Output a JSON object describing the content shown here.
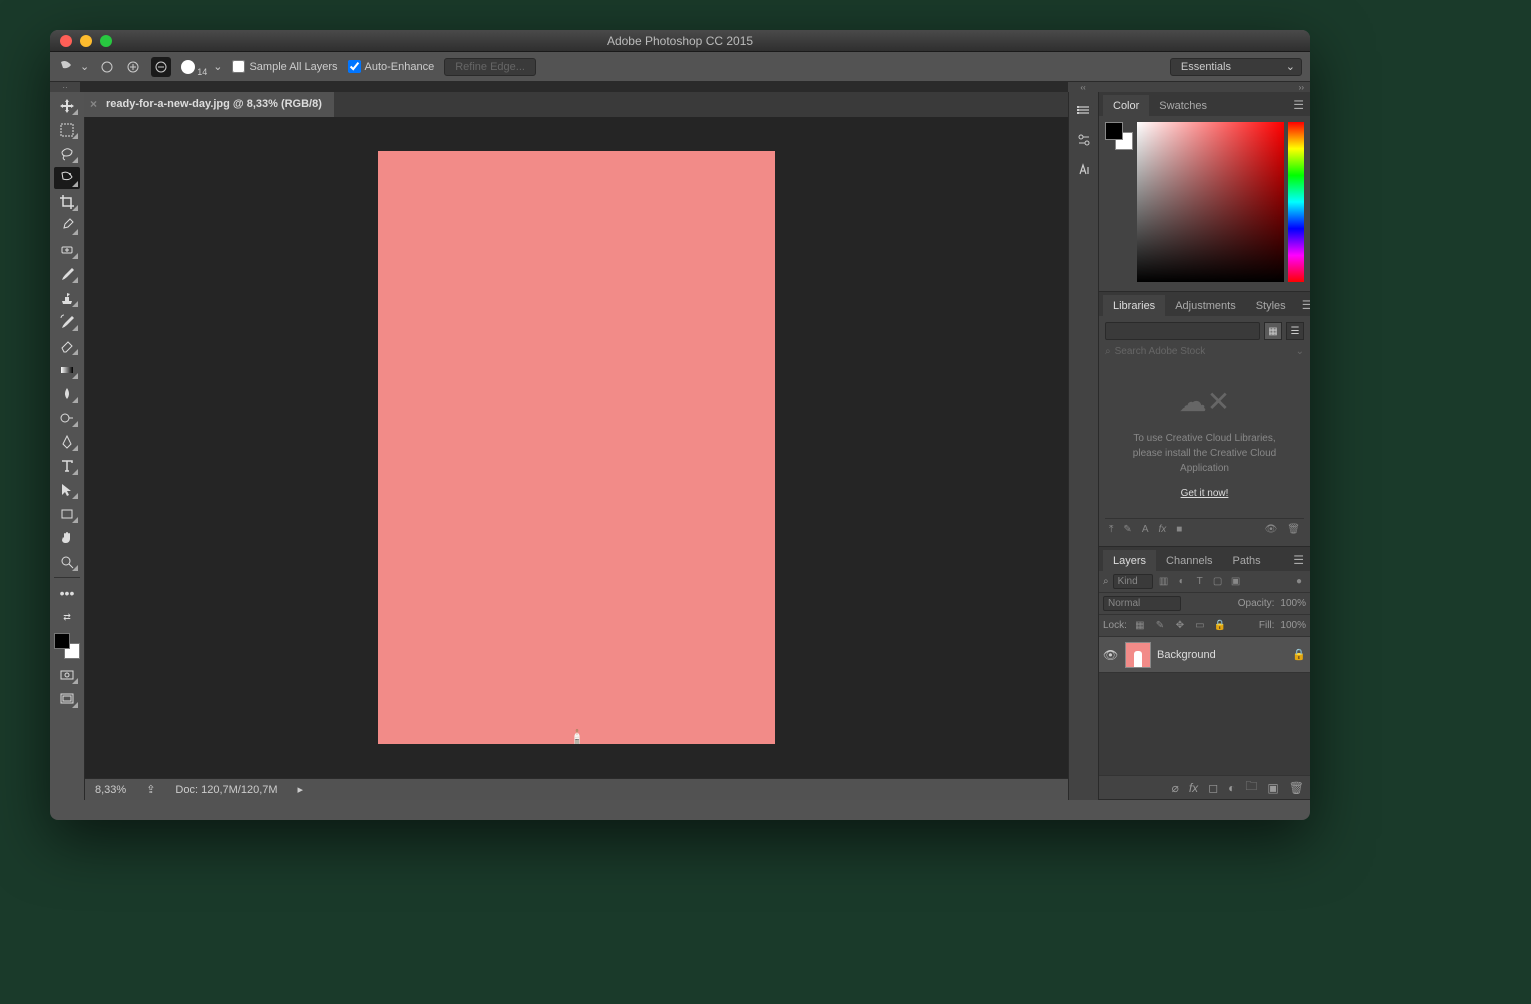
{
  "window": {
    "title": "Adobe Photoshop CC 2015"
  },
  "options": {
    "brush_size": "14",
    "sample_all_layers": {
      "label": "Sample All Layers",
      "checked": false
    },
    "auto_enhance": {
      "label": "Auto-Enhance",
      "checked": true
    },
    "refine_edge": "Refine Edge...",
    "workspace": "Essentials"
  },
  "document": {
    "tab_label": "ready-for-a-new-day.jpg @ 8,33% (RGB/8)"
  },
  "status": {
    "zoom": "8,33%",
    "doc_info": "Doc: 120,7M/120,7M"
  },
  "color_panel": {
    "tabs": [
      "Color",
      "Swatches"
    ]
  },
  "libraries_panel": {
    "tabs": [
      "Libraries",
      "Adjustments",
      "Styles"
    ],
    "search_placeholder": "Search Adobe Stock",
    "message_line1": "To use Creative Cloud Libraries,",
    "message_line2": "please install the Creative Cloud",
    "message_line3": "Application",
    "cta": "Get it now!"
  },
  "layers_panel": {
    "tabs": [
      "Layers",
      "Channels",
      "Paths"
    ],
    "filter_kind": "Kind",
    "blend_mode": "Normal",
    "opacity_label": "Opacity:",
    "opacity_value": "100%",
    "lock_label": "Lock:",
    "fill_label": "Fill:",
    "fill_value": "100%",
    "layers": [
      {
        "name": "Background",
        "locked": true
      }
    ]
  }
}
